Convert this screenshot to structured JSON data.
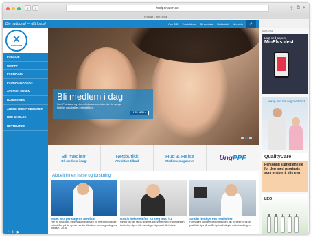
{
  "browser": {
    "address": "hudportalen.no",
    "tab_title": "Forside - min helse",
    "controls": [
      "⇪",
      "⧉",
      "+"
    ]
  },
  "topbar": {
    "tagline": "Din hudportal — ditt fokus!",
    "links": [
      "Om PPF",
      "Kontakt oss",
      "Bli medlem",
      "Nettbutikk",
      "Min side"
    ],
    "search_icon": "search-icon"
  },
  "logo": {
    "mark": "✕",
    "ribbon": "PSORIASIS"
  },
  "nav": {
    "items": [
      "FORSIDE",
      "OM PPF",
      "PSORIASIS",
      "PSORIASISARTRITT",
      "ATOPISK EKSEM",
      "HÅNDEKSEM",
      "ANDRE HUDSYKDOMMER",
      "HUD & HELSE",
      "NETTBUTIKK"
    ]
  },
  "social": [
    "f",
    "𝕥",
    "▶"
  ],
  "hero": {
    "title": "Bli medlem i dag",
    "text": "Som Psoriasis- og eksemforbundets medlem får du mange fordeler og rabatter i nettbutikken.",
    "button": "LES MER ›"
  },
  "tiles": [
    {
      "title": "Bli medlem",
      "sub": "Bli medlem i dag!"
    },
    {
      "title": "Nettbutikk",
      "sub": "Attraktive tilbud"
    },
    {
      "title": "Hud & Helse",
      "sub": "Medlemsmagasinet"
    },
    {
      "logo": "Ung",
      "logo_accent": "PPF"
    }
  ],
  "news": {
    "heading": "Aktuelt innen helse og forskning",
    "cards": [
      {
        "title": "Mate: Morgendagens medisin",
        "text": "Her fra forskning, informasjonsbransjen og nye teknologiske rolloutbåre på de nyeste norske tilbudene for morgendagens medisin i 2016."
      },
      {
        "title": "Gratis helsetelefon for deg med it1",
        "text": "Ringer du oss får du svar fra sykepleier med erfaring innen hudhelse. Åpen alle hverdager, tilpasset ditt behov."
      },
      {
        "title": "Se din føntlige om medisinen",
        "text": "Farmasøyt forklarer deg medisinen din, fordeler, bruk og praktiske tips så du får optimalt utbytte av behandlingen."
      }
    ]
  },
  "rail": {
    "label": "ANNONSE",
    "ad1_line1": "Last ned appen",
    "ad1_line2": "MinElvsblest",
    "ad2_text": "Viktig info for deg med hud",
    "ad3_brand": "QualityCare",
    "ad3_text": "Personlig støttetjeneste for deg med psoriasis som ønsker å vite mer",
    "ad4_brand": "LEO"
  },
  "colors": {
    "primary": "#1a85c9",
    "dark": "#0e5d96"
  }
}
